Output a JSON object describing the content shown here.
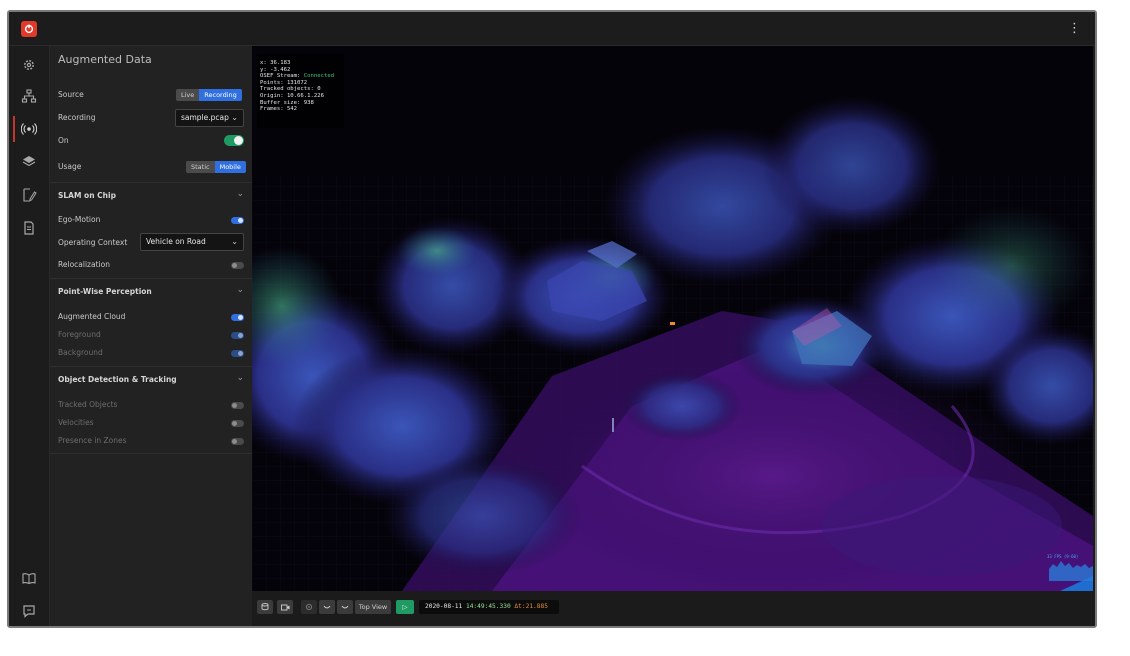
{
  "app": {
    "menu_glyph": "⋮",
    "brand_color": "#e03a2b"
  },
  "rail": {
    "items": [
      {
        "icon": "settings-gear-icon"
      },
      {
        "icon": "network-nodes-icon"
      },
      {
        "icon": "sensor-radar-icon",
        "active": true
      },
      {
        "icon": "layers-icon"
      },
      {
        "icon": "zone-edit-icon"
      },
      {
        "icon": "document-icon"
      }
    ],
    "bottom": [
      {
        "icon": "book-icon"
      },
      {
        "icon": "chat-icon"
      }
    ]
  },
  "panel": {
    "title": "Augmented Data",
    "source": {
      "label": "Source",
      "options": [
        "Live",
        "Recording"
      ],
      "selected": "Recording"
    },
    "recording": {
      "label": "Recording",
      "value": "sample.pcap"
    },
    "on": {
      "label": "On",
      "enabled": true
    },
    "usage": {
      "label": "Usage",
      "options": [
        "Static",
        "Mobile"
      ],
      "selected": "Mobile"
    },
    "slam": {
      "title": "SLAM on Chip",
      "ego_motion": {
        "label": "Ego-Motion",
        "enabled": true
      },
      "operating_context": {
        "label": "Operating Context",
        "value": "Vehicle on Road"
      },
      "relocalization": {
        "label": "Relocalization",
        "enabled": false
      }
    },
    "perception": {
      "title": "Point-Wise Perception",
      "augmented_cloud": {
        "label": "Augmented Cloud",
        "enabled": true
      },
      "foreground": {
        "label": "Foreground",
        "enabled": true
      },
      "background": {
        "label": "Background",
        "enabled": true
      }
    },
    "detection": {
      "title": "Object Detection & Tracking",
      "tracked_objects": {
        "label": "Tracked Objects",
        "enabled": false
      },
      "velocities": {
        "label": "Velocities",
        "enabled": false
      },
      "presence": {
        "label": "Presence in Zones",
        "enabled": false
      }
    }
  },
  "viewer": {
    "info": {
      "x": "x: 36.183",
      "y": "y: -3.462",
      "stream_label": "OSEF Stream: ",
      "stream_value": "Connected",
      "points": "Points: 131072",
      "tracked": "Tracked objects: 0",
      "origin": "Origin: 10.66.1.226",
      "buffer": "Buffer size: 938",
      "frames": "Frames: 542"
    },
    "fps": "33 FPS (9-60)"
  },
  "toolbar": {
    "top_view": "Top View",
    "play": "▷",
    "date": "2020-08-11 ",
    "time": "14:49:45.330 ",
    "delta": "Δt:21.885"
  }
}
